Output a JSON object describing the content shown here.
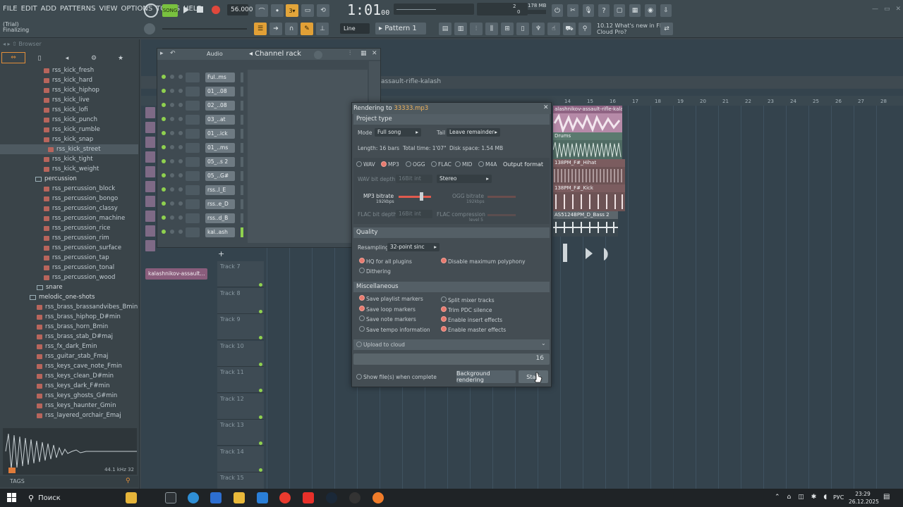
{
  "menu": [
    "FILE",
    "EDIT",
    "ADD",
    "PATTERNS",
    "VIEW",
    "OPTIONS",
    "TOOLS",
    "HELP"
  ],
  "transport": {
    "mode": "SONG",
    "tempo": "56.000",
    "time": "1:01",
    "time_sub": "00",
    "memory": "178 MB",
    "cpu_val1": "2",
    "cpu_val2": "0"
  },
  "status": {
    "line1": "(Trial)",
    "line2": "Finalizing"
  },
  "toolbar2": {
    "snap": "Line",
    "pattern": "Pattern 1"
  },
  "news": {
    "line1": "10.12  What's new in FL",
    "line2": "Cloud Pro?"
  },
  "browser": {
    "title": "Browser",
    "items": [
      {
        "label": "rss_kick_fresh",
        "type": "file"
      },
      {
        "label": "rss_kick_hard",
        "type": "file"
      },
      {
        "label": "rss_kick_hiphop",
        "type": "file"
      },
      {
        "label": "rss_kick_live",
        "type": "file"
      },
      {
        "label": "rss_kick_lofi",
        "type": "file"
      },
      {
        "label": "rss_kick_punch",
        "type": "file"
      },
      {
        "label": "rss_kick_rumble",
        "type": "file"
      },
      {
        "label": "rss_kick_snap",
        "type": "file"
      },
      {
        "label": "rss_kick_street",
        "type": "file-selected"
      },
      {
        "label": "rss_kick_tight",
        "type": "file"
      },
      {
        "label": "rss_kick_weight",
        "type": "file"
      },
      {
        "label": "percussion",
        "type": "folder"
      },
      {
        "label": "rss_percussion_block",
        "type": "file"
      },
      {
        "label": "rss_percussion_bongo",
        "type": "file"
      },
      {
        "label": "rss_percussion_classy",
        "type": "file"
      },
      {
        "label": "rss_percussion_machine",
        "type": "file"
      },
      {
        "label": "rss_percussion_rice",
        "type": "file"
      },
      {
        "label": "rss_percussion_rim",
        "type": "file"
      },
      {
        "label": "rss_percussion_surface",
        "type": "file"
      },
      {
        "label": "rss_percussion_tap",
        "type": "file"
      },
      {
        "label": "rss_percussion_tonal",
        "type": "file"
      },
      {
        "label": "rss_percussion_wood",
        "type": "file"
      },
      {
        "label": "snare",
        "type": "folder"
      },
      {
        "label": "melodic_one-shots",
        "type": "folder"
      },
      {
        "label": "rss_brass_brassandvibes_Bmin",
        "type": "file"
      },
      {
        "label": "rss_brass_hiphop_D#min",
        "type": "file"
      },
      {
        "label": "rss_brass_horn_Bmin",
        "type": "file"
      },
      {
        "label": "rss_brass_stab_D#maj",
        "type": "file"
      },
      {
        "label": "rss_fx_dark_Emin",
        "type": "file"
      },
      {
        "label": "rss_guitar_stab_Fmaj",
        "type": "file"
      },
      {
        "label": "rss_keys_cave_note_Fmin",
        "type": "file"
      },
      {
        "label": "rss_keys_clean_D#min",
        "type": "file"
      },
      {
        "label": "rss_keys_dark_F#min",
        "type": "file"
      },
      {
        "label": "rss_keys_ghosts_G#min",
        "type": "file"
      },
      {
        "label": "rss_keys_haunter_Gmin",
        "type": "file"
      },
      {
        "label": "rss_layered_orchair_Emaj",
        "type": "file"
      }
    ],
    "waveform_info": "44.1 kHz 32",
    "tags_label": "TAGS"
  },
  "channel_rack": {
    "title": "Channel rack",
    "filter": "Audio",
    "channels": [
      "Ful..ms",
      "01_..08",
      "02_..08",
      "03_..at",
      "01_..ick",
      "01_..ms",
      "05_..s 2",
      "05_..G#",
      "rss..l_E",
      "rss..e_D",
      "rss..d_B",
      "kal..ash"
    ]
  },
  "playlist": {
    "title": "assault-rifle-kalash",
    "ruler": [
      "14",
      "15",
      "16",
      "17",
      "18",
      "19",
      "20",
      "21",
      "22",
      "23",
      "24",
      "25",
      "26",
      "27",
      "28"
    ],
    "tracks": [
      "Track 7",
      "Track 8",
      "Track 9",
      "Track 10",
      "Track 11",
      "Track 12",
      "Track 13",
      "Track 14",
      "Track 15"
    ],
    "clips": [
      "alashnikov-assault-rifle-kalash",
      "Drums",
      "138PM_F#_Hihat",
      "138PM_F#_Kick",
      "AS5124BPM_D_Bass 2"
    ],
    "picker_clip": "kalashnikov-assault..."
  },
  "render": {
    "title_prefix": "Rendering to ",
    "filename": "33333.mp3",
    "project_type": "Project type",
    "mode_label": "Mode",
    "mode_value": "Full song",
    "tail_label": "Tail",
    "tail_value": "Leave remainder",
    "length": "Length: 16 bars",
    "total_time": "Total time: 1'07\"",
    "disk_space": "Disk space: 1.54 MB",
    "formats": [
      "WAV",
      "MP3",
      "OGG",
      "FLAC",
      "MID",
      "M4A"
    ],
    "output_format": "Output format",
    "wav_bit_depth": "WAV bit depth",
    "wav_bit_value": "16Bit int",
    "channels": "Stereo",
    "mp3_bitrate": "MP3 bitrate",
    "mp3_bitrate_val": "192kbps",
    "ogg_bitrate": "OGG bitrate",
    "ogg_bitrate_val": "192kbps",
    "flac_bit_depth": "FLAC bit depth",
    "flac_bit_value": "16Bit int",
    "flac_compression": "FLAC compression",
    "flac_compression_val": "level 5",
    "quality": "Quality",
    "resampling_label": "Resampling",
    "resampling_value": "32-point sinc",
    "hq_plugins": "HQ for all plugins",
    "disable_polyphony": "Disable maximum polyphony",
    "dithering": "Dithering",
    "misc": "Miscellaneous",
    "save_playlist_markers": "Save playlist markers",
    "save_loop_markers": "Save loop markers",
    "save_note_markers": "Save note markers",
    "save_tempo_info": "Save tempo information",
    "split_mixer": "Split mixer tracks",
    "trim_pdc": "Trim PDC silence",
    "enable_insert": "Enable insert effects",
    "enable_master": "Enable master effects",
    "upload_cloud": "Upload to cloud",
    "progress_value": "16",
    "show_files": "Show file(s) when complete",
    "background_rendering": "Background rendering",
    "start": "Start"
  },
  "taskbar": {
    "search": "Поиск",
    "lang": "РУС",
    "time": "23:29",
    "date": "26.12.2025"
  }
}
